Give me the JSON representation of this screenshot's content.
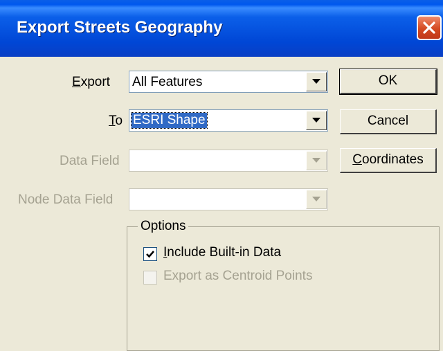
{
  "window": {
    "title": "Export Streets Geography"
  },
  "fields": {
    "export": {
      "label": "Export",
      "accesskey": "E",
      "label_rest": "xport",
      "value": "All Features"
    },
    "to": {
      "label": "To",
      "accesskey": "T",
      "label_rest": "o",
      "value": "ESRI Shape"
    },
    "data_field": {
      "label": "Data Field",
      "value": ""
    },
    "node_data_field": {
      "label": "Node Data Field",
      "value": ""
    }
  },
  "buttons": {
    "ok": "OK",
    "cancel": "Cancel",
    "coordinates": {
      "label": "Coordinates",
      "accesskey": "C",
      "label_rest": "oordinates"
    }
  },
  "options": {
    "legend": "Options",
    "include_builtin": {
      "label": "Include Built-in Data",
      "accesskey": "I",
      "label_rest": "nclude Built-in Data",
      "checked": true,
      "enabled": true
    },
    "export_centroid": {
      "label": "Export as Centroid Points",
      "checked": false,
      "enabled": false
    }
  },
  "icons": {
    "close": "close-icon",
    "dropdown": "chevron-down-icon",
    "checkmark": "checkmark-icon"
  },
  "colors": {
    "titlebar": "#0046d5",
    "dialog_bg": "#ece9d8",
    "selection": "#316ac5",
    "disabled_text": "#a5a291",
    "close_button": "#d44a22"
  }
}
